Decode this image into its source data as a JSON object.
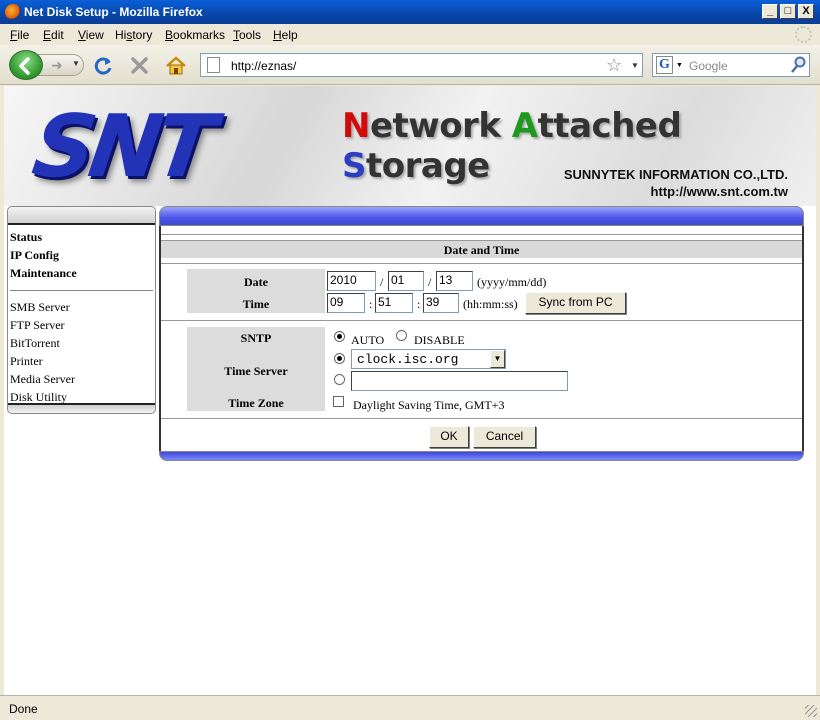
{
  "window": {
    "title": "Net Disk Setup - Mozilla Firefox",
    "min": "_",
    "max": "□",
    "close": "X"
  },
  "menu": [
    "File",
    "Edit",
    "View",
    "History",
    "Bookmarks",
    "Tools",
    "Help"
  ],
  "menu_mnemonics": [
    "F",
    "E",
    "V",
    "s",
    "B",
    "T",
    "H"
  ],
  "toolbar": {
    "url": "http://eznas/",
    "search_placeholder": "Google",
    "search_engine_letter": "G"
  },
  "banner": {
    "logo": "SNT",
    "title_parts": [
      "N",
      "etwork ",
      "A",
      "ttached ",
      "S",
      "torage"
    ],
    "company_name": "SUNNYTEK INFORMATION CO.,LTD.",
    "company_url": "http://www.snt.com.tw"
  },
  "sidebar": {
    "primary": [
      "Status",
      "IP Config",
      "Maintenance"
    ],
    "secondary": [
      "SMB Server",
      "FTP Server",
      "BitTorrent",
      "Printer",
      "Media Server",
      "Disk Utility"
    ]
  },
  "section": {
    "title": "Date and Time"
  },
  "datetime": {
    "date_label": "Date",
    "year": "2010",
    "month": "01",
    "day": "13",
    "date_sep": "/",
    "date_format": "(yyyy/mm/dd)",
    "time_label": "Time",
    "hour": "09",
    "minute": "51",
    "second": "39",
    "time_sep": ":",
    "time_format": "(hh:mm:ss)",
    "sync_button": "Sync from PC"
  },
  "sntp": {
    "label": "SNTP",
    "auto_label": "AUTO",
    "disable_label": "DISABLE",
    "time_server_label": "Time Server",
    "time_server_value": "clock.isc.org",
    "custom_server_value": "",
    "time_zone_label": "Time Zone",
    "dst_label": "Daylight Saving Time, GMT+3"
  },
  "actions": {
    "ok": "OK",
    "cancel": "Cancel"
  },
  "status": {
    "text": "Done"
  },
  "colors": {
    "titlebar": "#0846a8",
    "panel_header": "#4a55e8",
    "logo_blue": "#2333b8",
    "label_bg": "#dcdcdc"
  }
}
